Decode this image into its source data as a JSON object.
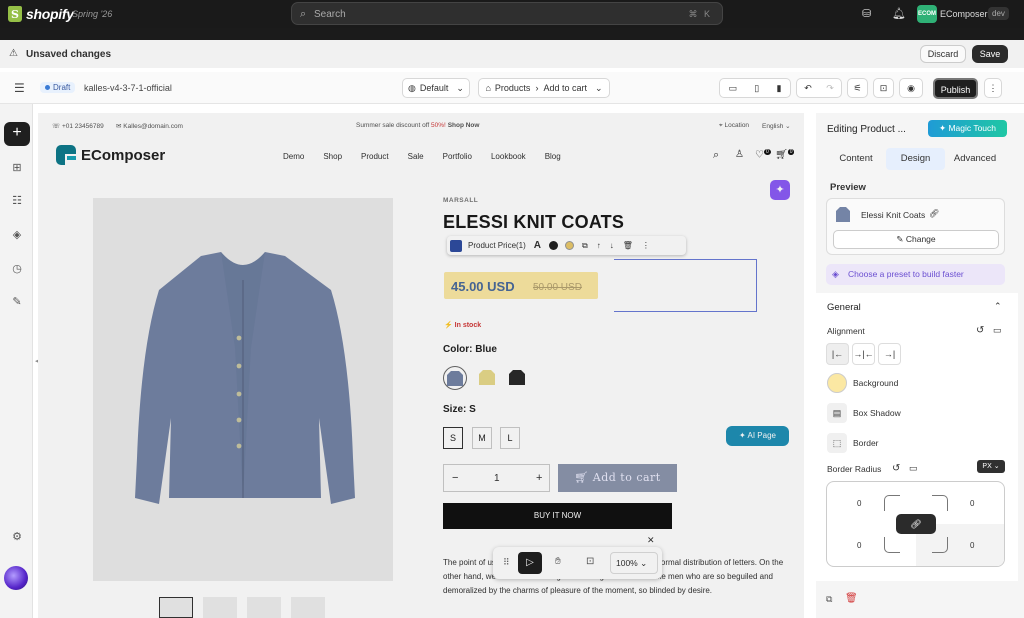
{
  "topbar": {
    "logo_text": "shopify",
    "edition": "Spring '26",
    "search_placeholder": "Search",
    "shortcut": "⌘ K",
    "store_initials": "ECOM",
    "store_name": "EComposer",
    "env_badge": "dev"
  },
  "unsaved_bar": {
    "message": "Unsaved changes",
    "discard_label": "Discard",
    "save_label": "Save"
  },
  "toolbar": {
    "status": "Draft",
    "theme_name": "kalles-v4-3-7-1-official",
    "device_preset": "Default",
    "breadcrumb_root": "Products",
    "breadcrumb_leaf": "Add to cart",
    "publish_label": "Publish"
  },
  "store": {
    "announcement": {
      "phone": "+01 23456789",
      "email": "Kalles@domain.com",
      "promo_prefix": "Summer sale discount off",
      "promo_percent": "50%!",
      "promo_link": "Shop Now",
      "location": "Location",
      "language": "English"
    },
    "brand": "EComposer",
    "nav": [
      "Demo",
      "Shop",
      "Product",
      "Sale",
      "Portfolio",
      "Lookbook",
      "Blog"
    ],
    "wishlist_count": "0",
    "cart_count": "0"
  },
  "product": {
    "vendor": "MARSALL",
    "title": "ELESSI KNIT COATS",
    "price": "45.00 USD",
    "compare_price": "50.00 USD",
    "stock": "In stock",
    "color_label": "Color:",
    "color_value": "Blue",
    "size_label": "Size:",
    "size_value": "S",
    "sizes": [
      "S",
      "M",
      "L"
    ],
    "quantity": "1",
    "add_to_cart": "Add to cart",
    "buy_now": "BUY IT NOW",
    "description": "The point of using Lorem Ipsum is that it has a more-or-less normal distribution of letters. On the other hand, we denounce with righteous indignation and dislike men who are so beguiled and demoralized by the charms of pleasure of the moment, so blinded by desire."
  },
  "element_toolbar": {
    "element_name": "Product Price(1)"
  },
  "floating": {
    "ai_page_label": "AI Page",
    "zoom": "100%"
  },
  "panel": {
    "title": "Editing Product ...",
    "magic_touch": "Magic Touch",
    "tabs": [
      "Content",
      "Design",
      "Advanced"
    ],
    "active_tab": "Design",
    "preview_label": "Preview",
    "preview_product": "Elessi Knit Coats",
    "change_label": "Change",
    "preset_text": "Choose a preset to build faster",
    "general_label": "General",
    "alignment_label": "Alignment",
    "background_label": "Background",
    "box_shadow_label": "Box Shadow",
    "border_label": "Border",
    "border_radius_label": "Border Radius",
    "unit": "PX",
    "radius_values": [
      "0",
      "0",
      "0",
      "0"
    ]
  },
  "colors": {
    "price_highlight": "#fbe8a3",
    "accent_blue": "#6a7bd8",
    "ai_page": "#1f8fb5",
    "magic_touch": "#1fb0c0"
  }
}
